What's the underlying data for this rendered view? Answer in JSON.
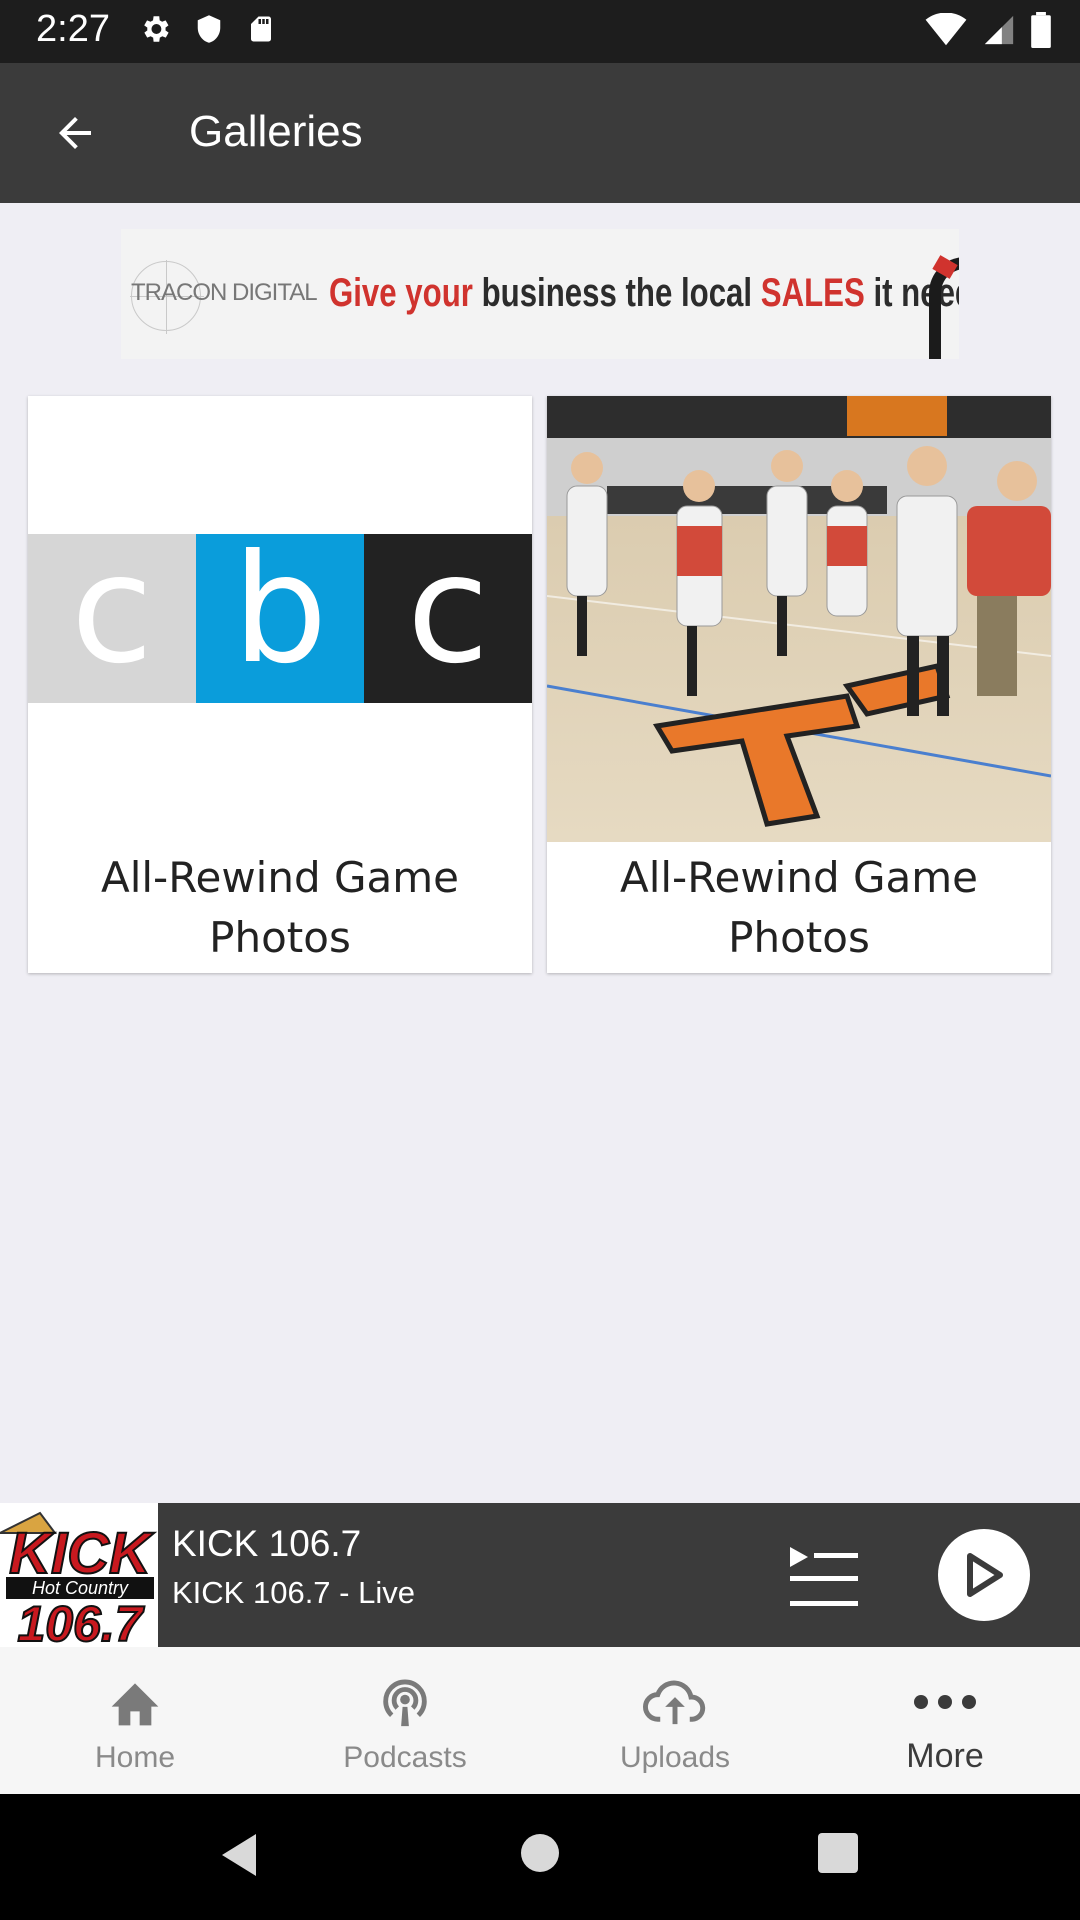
{
  "status_bar": {
    "time": "2:27",
    "left_icons": [
      "gear-icon",
      "shield-icon",
      "sd-card-icon"
    ],
    "right_icons": [
      "wifi-icon",
      "signal-icon",
      "battery-icon"
    ]
  },
  "app_bar": {
    "back_icon": "arrow-back-icon",
    "title": "Galleries"
  },
  "banner": {
    "brand": "TRACON DIGITAL",
    "text_part1": "Give your",
    "text_part2": " business the local ",
    "text_part3": "SALES",
    "text_part4": " it needs"
  },
  "galleries": [
    {
      "title": "All-Rewind Game Photos",
      "image": "cbc-logo",
      "cbc_letters": [
        "c",
        "b",
        "c"
      ],
      "colors": [
        "#d6d6d6",
        "#0a9ddb",
        "#222222"
      ]
    },
    {
      "title": "All-Rewind Game Photos",
      "image": "basketball-team-photo"
    }
  ],
  "player": {
    "station_logo_text_top": "KICK",
    "station_logo_text_mid": "Hot Country",
    "station_logo_text_bottom": "106.7",
    "title": "KICK 106.7",
    "subtitle": "KICK 106.7 - Live"
  },
  "bottom_nav": [
    {
      "label": "Home",
      "icon": "home-icon",
      "active": false
    },
    {
      "label": "Podcasts",
      "icon": "podcast-icon",
      "active": false
    },
    {
      "label": "Uploads",
      "icon": "cloud-upload-icon",
      "active": false
    },
    {
      "label": "More",
      "icon": "more-dots-icon",
      "active": true
    }
  ],
  "colors": {
    "app_bar": "#3b3b3b",
    "status_bar": "#1d1d1d",
    "background": "#efeef4",
    "banner_red": "#d0332e"
  }
}
